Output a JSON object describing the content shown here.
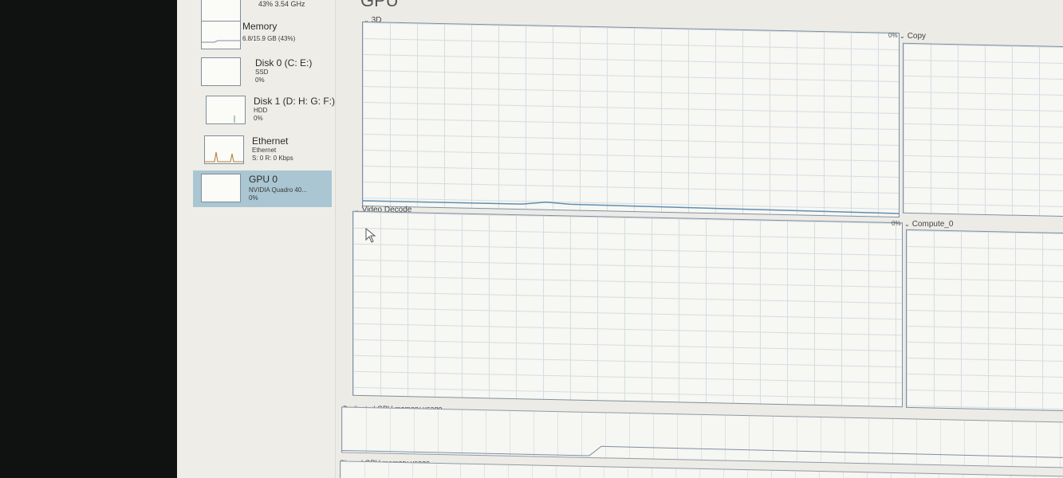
{
  "sidebar": {
    "items": [
      {
        "title": "",
        "sub1": "43%  3.54 GHz",
        "sub2": ""
      },
      {
        "title": "Memory",
        "sub1": "6.8/15.9 GB (43%)",
        "sub2": ""
      },
      {
        "title": "Disk 0 (C: E:)",
        "sub1": "SSD",
        "sub2": "0%"
      },
      {
        "title": "Disk 1 (D: H: G: F:)",
        "sub1": "HDD",
        "sub2": "0%"
      },
      {
        "title": "Ethernet",
        "sub1": "Ethernet",
        "sub2": "S: 0 R: 0 Kbps"
      },
      {
        "title": "GPU 0",
        "sub1": "NVIDIA Quadro 40...",
        "sub2": "0%"
      }
    ]
  },
  "main": {
    "title": "GPU",
    "graphs": {
      "g3d": {
        "label": "3D",
        "pct": ""
      },
      "copy": {
        "label": "Copy",
        "pct": "0%"
      },
      "video_decode": {
        "label": "Video Decode",
        "pct": ""
      },
      "compute": {
        "label": "Compute_0",
        "pct": "0%"
      }
    },
    "dedicated_label": "Dedicated GPU memory usage",
    "shared_label": "Shared GPU memory usage"
  },
  "colors": {
    "accent": "#a9c6d2",
    "graph_line": "#5f8fb0"
  }
}
